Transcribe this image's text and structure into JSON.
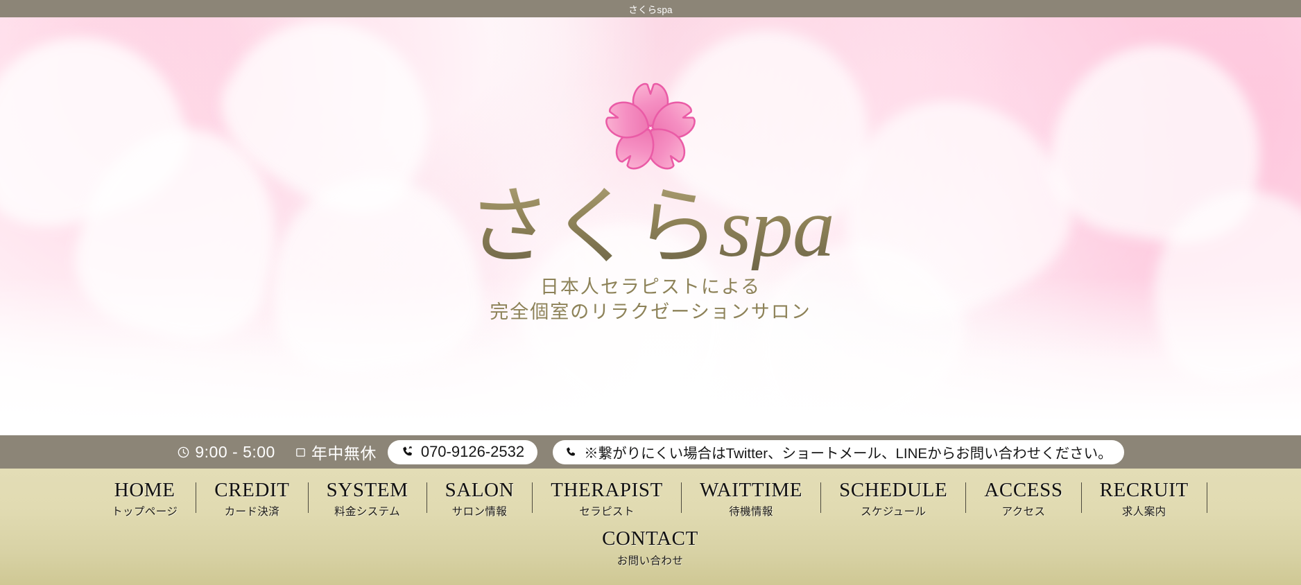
{
  "window": {
    "title": "さくらspa"
  },
  "hero": {
    "logo_icon": "sakura-flower-icon",
    "logo_text_jp": "さくら",
    "logo_text_latin": "spa",
    "tagline_line1": "日本人セラピストによる",
    "tagline_line2": "完全個室のリラクゼーションサロン"
  },
  "infobar": {
    "clock_icon": "clock-icon",
    "hours": "9:00 - 5:00",
    "calendar_icon": "calendar-icon",
    "open_days": "年中無休",
    "phone_icon": "phone-icon",
    "phone": "070-9126-2532",
    "note_icon": "phone-icon",
    "note": "※繋がりにくい場合はTwitter、ショートメール、LINEからお問い合わせください。"
  },
  "nav": {
    "row1": [
      {
        "en": "HOME",
        "jp": "トップページ"
      },
      {
        "en": "CREDIT",
        "jp": "カード決済"
      },
      {
        "en": "SYSTEM",
        "jp": "料金システム"
      },
      {
        "en": "SALON",
        "jp": "サロン情報"
      },
      {
        "en": "THERAPIST",
        "jp": "セラピスト"
      },
      {
        "en": "WAITTIME",
        "jp": "待機情報"
      },
      {
        "en": "SCHEDULE",
        "jp": "スケジュール"
      },
      {
        "en": "ACCESS",
        "jp": "アクセス"
      },
      {
        "en": "RECRUIT",
        "jp": "求人案内"
      }
    ],
    "row2": [
      {
        "en": "CONTACT",
        "jp": "お問い合わせ"
      }
    ]
  },
  "colors": {
    "chrome_taupe": "#8c8577",
    "nav_beige": "#e3ddb6",
    "logo_gold": "#8e8257",
    "sakura_pink": "#f472b6",
    "hero_pink": "#fdeaf1"
  }
}
